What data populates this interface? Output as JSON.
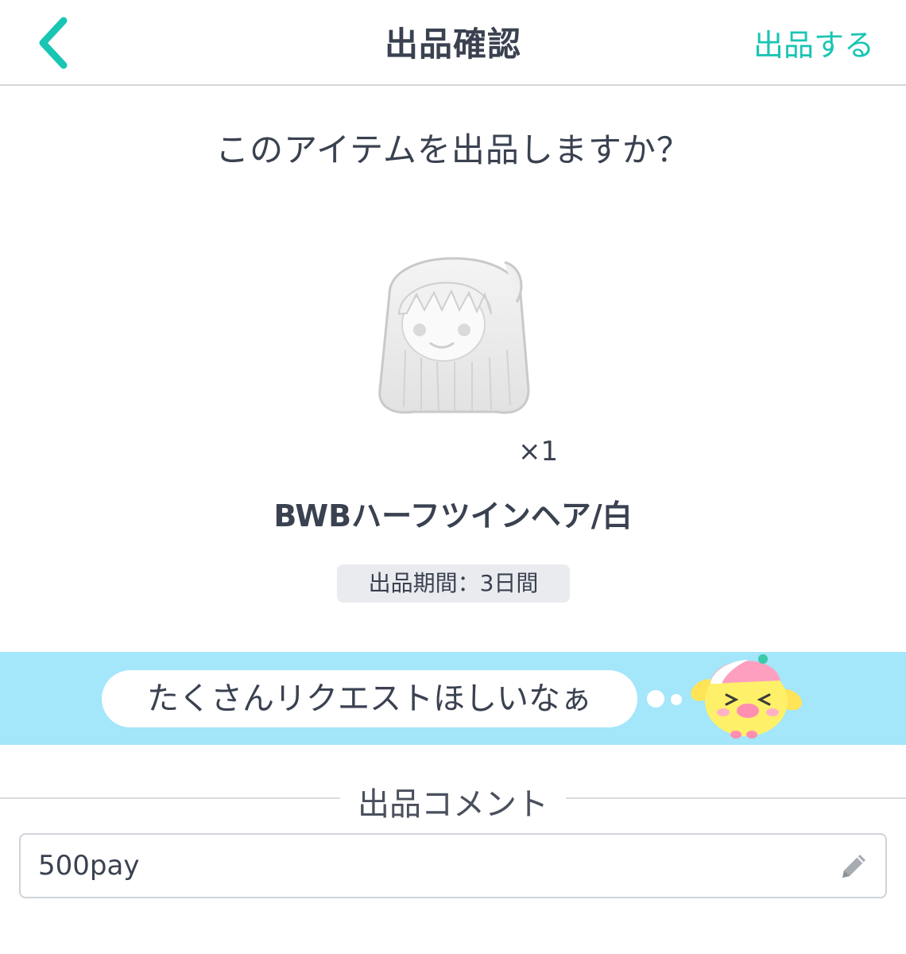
{
  "header": {
    "back_icon": "chevron-left-icon",
    "title": "出品確認",
    "submit_label": "出品する",
    "accent_color": "#19c5b3"
  },
  "confirm": {
    "question": "このアイテムを出品しますか？",
    "item_icon": "half-twin-hair-item-icon",
    "quantity": "×1",
    "item_name": "BWBハーフツインヘア/白",
    "period_label": "出品期間：3日間"
  },
  "banner": {
    "message": "たくさんリクエストほしいなぁ",
    "mascot_icon": "bird-mascot-icon",
    "background_color": "#a4e6fa"
  },
  "comment": {
    "section_title": "出品コメント",
    "value": "500pay",
    "edit_icon": "pencil-icon"
  }
}
